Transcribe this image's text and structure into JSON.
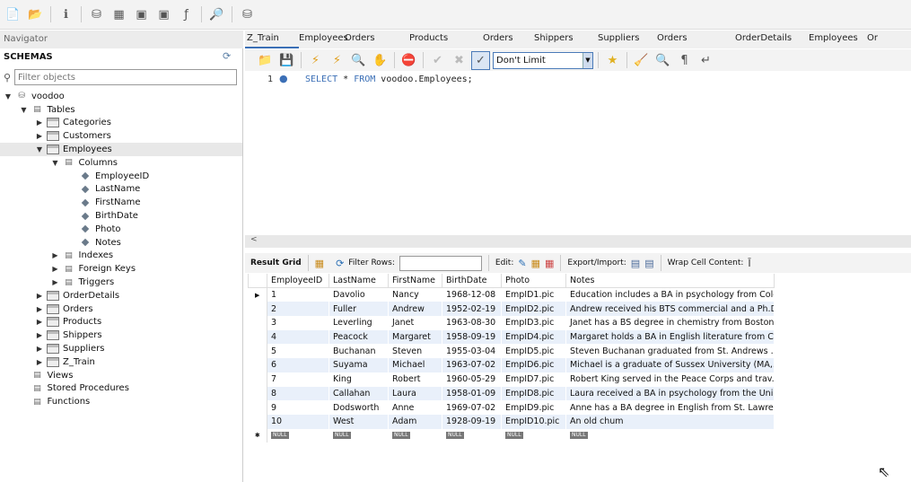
{
  "toolbar": {
    "icons": [
      "new-sql-tab-icon",
      "open-sql-file-icon",
      "inspector-icon",
      "create-schema-icon",
      "create-table-icon",
      "create-view-icon",
      "create-procedure-icon",
      "create-function-icon",
      "search-table-data-icon",
      "reconnect-icon"
    ]
  },
  "navigator": {
    "title": "Navigator",
    "schemas_label": "SCHEMAS",
    "filter_placeholder": "Filter objects",
    "tree": [
      {
        "label": "voodoo",
        "level": 0,
        "kind": "db",
        "open": true
      },
      {
        "label": "Tables",
        "level": 1,
        "kind": "folder",
        "open": true
      },
      {
        "label": "Categories",
        "level": 2,
        "kind": "table",
        "open": false
      },
      {
        "label": "Customers",
        "level": 2,
        "kind": "table",
        "open": false
      },
      {
        "label": "Employees",
        "level": 2,
        "kind": "table",
        "open": true,
        "selected": true
      },
      {
        "label": "Columns",
        "level": 3,
        "kind": "folder",
        "open": true
      },
      {
        "label": "EmployeeID",
        "level": 4,
        "kind": "column"
      },
      {
        "label": "LastName",
        "level": 4,
        "kind": "column"
      },
      {
        "label": "FirstName",
        "level": 4,
        "kind": "column"
      },
      {
        "label": "BirthDate",
        "level": 4,
        "kind": "column"
      },
      {
        "label": "Photo",
        "level": 4,
        "kind": "column"
      },
      {
        "label": "Notes",
        "level": 4,
        "kind": "column"
      },
      {
        "label": "Indexes",
        "level": 3,
        "kind": "folder",
        "open": false
      },
      {
        "label": "Foreign Keys",
        "level": 3,
        "kind": "folder",
        "open": false
      },
      {
        "label": "Triggers",
        "level": 3,
        "kind": "folder",
        "open": false
      },
      {
        "label": "OrderDetails",
        "level": 2,
        "kind": "table",
        "open": false
      },
      {
        "label": "Orders",
        "level": 2,
        "kind": "table",
        "open": false
      },
      {
        "label": "Products",
        "level": 2,
        "kind": "table",
        "open": false
      },
      {
        "label": "Shippers",
        "level": 2,
        "kind": "table",
        "open": false
      },
      {
        "label": "Suppliers",
        "level": 2,
        "kind": "table",
        "open": false
      },
      {
        "label": "Z_Train",
        "level": 2,
        "kind": "table",
        "open": false
      },
      {
        "label": "Views",
        "level": 1,
        "kind": "folder"
      },
      {
        "label": "Stored Procedures",
        "level": 1,
        "kind": "folder"
      },
      {
        "label": "Functions",
        "level": 1,
        "kind": "folder"
      }
    ]
  },
  "tabs": [
    "Z_Train",
    "Employees",
    "Orders",
    "Products",
    "Orders",
    "Shippers",
    "Suppliers",
    "Orders",
    "OrderDetails",
    "Employees",
    "Or"
  ],
  "editor": {
    "limit": "Don't Limit",
    "line_number": "1",
    "sql_keyword1": "SELECT",
    "sql_mid": " * ",
    "sql_keyword2": "FROM",
    "sql_rest": " voodoo.Employees;"
  },
  "results": {
    "result_grid": "Result Grid",
    "filter_rows": "Filter Rows:",
    "edit": "Edit:",
    "export_import": "Export/Import:",
    "wrap": "Wrap Cell Content:",
    "columns": [
      "EmployeeID",
      "LastName",
      "FirstName",
      "BirthDate",
      "Photo",
      "Notes"
    ],
    "rows": [
      [
        "1",
        "Davolio",
        "Nancy",
        "1968-12-08",
        "EmpID1.pic",
        "Education includes a BA in psychology from Colo..."
      ],
      [
        "2",
        "Fuller",
        "Andrew",
        "1952-02-19",
        "EmpID2.pic",
        "Andrew received his BTS commercial and a Ph.D..."
      ],
      [
        "3",
        "Leverling",
        "Janet",
        "1963-08-30",
        "EmpID3.pic",
        "Janet has a BS degree in chemistry from Boston..."
      ],
      [
        "4",
        "Peacock",
        "Margaret",
        "1958-09-19",
        "EmpID4.pic",
        "Margaret holds a BA in English literature from C..."
      ],
      [
        "5",
        "Buchanan",
        "Steven",
        "1955-03-04",
        "EmpID5.pic",
        "Steven Buchanan graduated from St. Andrews ..."
      ],
      [
        "6",
        "Suyama",
        "Michael",
        "1963-07-02",
        "EmpID6.pic",
        "Michael is a graduate of Sussex University (MA,..."
      ],
      [
        "7",
        "King",
        "Robert",
        "1960-05-29",
        "EmpID7.pic",
        "Robert King served in the Peace Corps and trav..."
      ],
      [
        "8",
        "Callahan",
        "Laura",
        "1958-01-09",
        "EmpID8.pic",
        "Laura received a BA in psychology from the Uni..."
      ],
      [
        "9",
        "Dodsworth",
        "Anne",
        "1969-07-02",
        "EmpID9.pic",
        "Anne has a BA degree in English from St. Lawre..."
      ],
      [
        "10",
        "West",
        "Adam",
        "1928-09-19",
        "EmpID10.pic",
        "An old chum"
      ]
    ],
    "null_label": "NULL"
  }
}
